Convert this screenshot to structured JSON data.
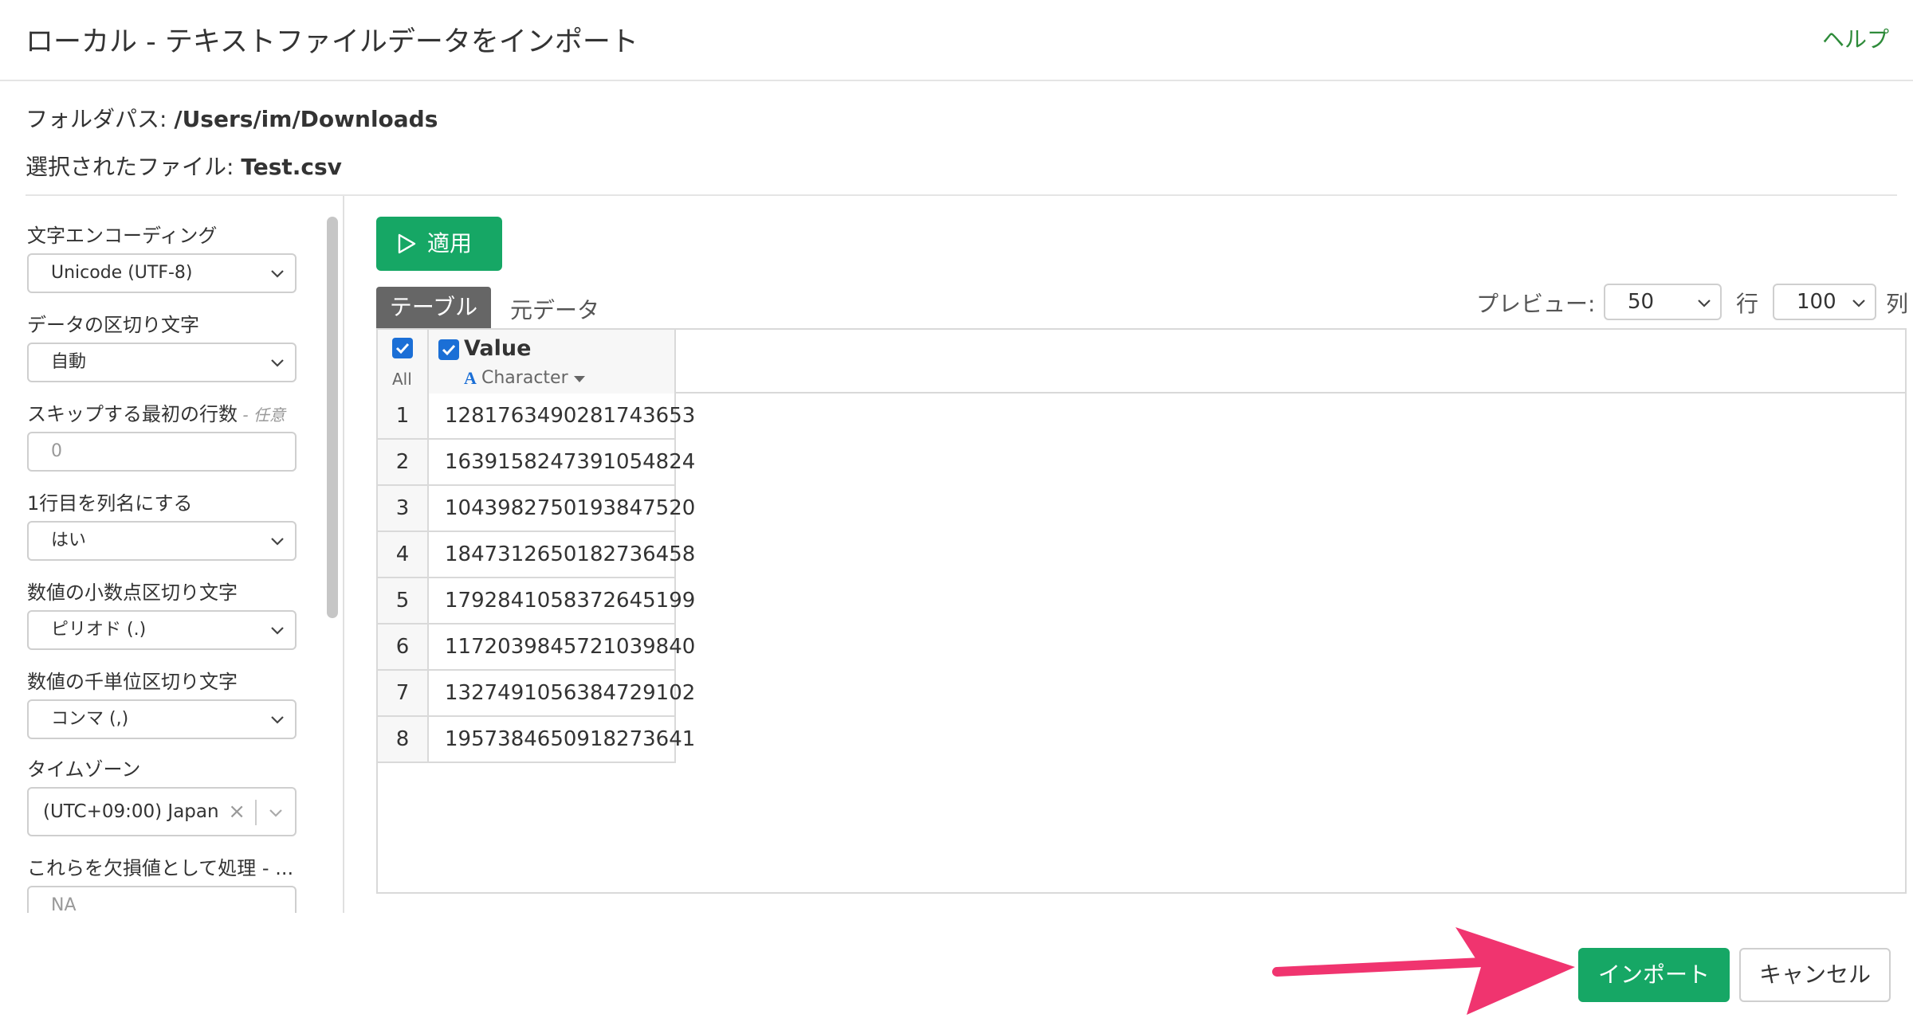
{
  "header": {
    "title": "ローカル - テキストファイルデータをインポート",
    "help": "ヘルプ"
  },
  "info": {
    "folder_label": "フォルダパス: ",
    "folder_value": "/Users/im/Downloads",
    "file_label": "選択されたファイル: ",
    "file_value": "Test.csv"
  },
  "settings": {
    "encoding": {
      "label": "文字エンコーディング",
      "value": "Unicode (UTF-8)"
    },
    "delimiter": {
      "label": "データの区切り文字",
      "value": "自動"
    },
    "skip": {
      "label": "スキップする最初の行数",
      "optional": " - 任意",
      "placeholder": "0"
    },
    "header_row": {
      "label": "1行目を列名にする",
      "value": "はい"
    },
    "decimal": {
      "label": "数値の小数点区切り文字",
      "value": "ピリオド (.)"
    },
    "thousands": {
      "label": "数値の千単位区切り文字",
      "value": "コンマ (,)"
    },
    "timezone": {
      "label": "タイムゾーン",
      "value": "(UTC+09:00) Japan",
      "clear": "×"
    },
    "na": {
      "label": "これらを欠損値として処理 - ...",
      "placeholder": "NA"
    }
  },
  "toolbar": {
    "apply": "適用"
  },
  "tabs": {
    "table": "テーブル",
    "raw": "元データ"
  },
  "preview": {
    "label": "プレビュー:",
    "rows_value": "50",
    "rows_unit": "行",
    "cols_value": "100",
    "cols_unit": "列"
  },
  "grid": {
    "all_label": "All",
    "column": {
      "name": "Value",
      "type_icon": "A",
      "type": "Character"
    },
    "rows": [
      {
        "i": "1",
        "v": "1281763490281743653"
      },
      {
        "i": "2",
        "v": "1639158247391054824"
      },
      {
        "i": "3",
        "v": "1043982750193847520"
      },
      {
        "i": "4",
        "v": "1847312650182736458"
      },
      {
        "i": "5",
        "v": "1792841058372645199"
      },
      {
        "i": "6",
        "v": "1172039845721039840"
      },
      {
        "i": "7",
        "v": "1327491056384729102"
      },
      {
        "i": "8",
        "v": "1957384650918273641"
      }
    ]
  },
  "footer": {
    "import": "インポート",
    "cancel": "キャンセル"
  },
  "colors": {
    "accent": "#16a765",
    "help": "#2e8b3a",
    "checkbox": "#1b6fd6",
    "annotation_arrow": "#f0346f"
  }
}
